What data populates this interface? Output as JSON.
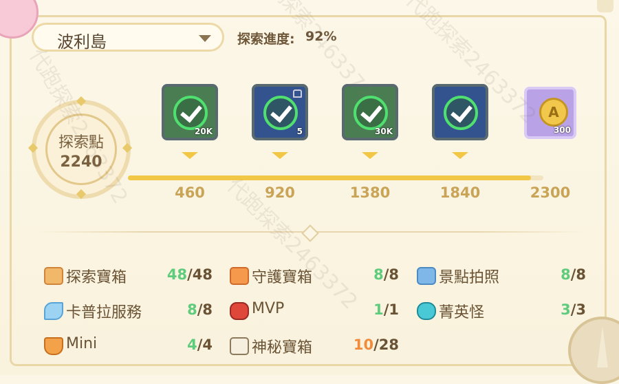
{
  "region_selector": {
    "value": "波利島"
  },
  "progress": {
    "label": "探索進度:",
    "value": "92%"
  },
  "points": {
    "title": "探索點",
    "value": "2240"
  },
  "milestones": [
    {
      "value": "460",
      "reward_qty": "20K",
      "reward_icon": "coin-chest-icon",
      "claimed": true,
      "locked": false
    },
    {
      "value": "920",
      "reward_qty": "5",
      "reward_icon": "ore-icon",
      "claimed": true,
      "locked": true
    },
    {
      "value": "1380",
      "reward_qty": "30K",
      "reward_icon": "coin-chest-icon",
      "claimed": true,
      "locked": false
    },
    {
      "value": "1840",
      "reward_qty": "",
      "reward_icon": "gem-bag-icon",
      "claimed": true,
      "locked": false
    },
    {
      "value": "2300",
      "reward_qty": "300",
      "reward_icon": "a-coin-icon",
      "claimed": false,
      "locked": false
    }
  ],
  "reward_coin_letter": "A",
  "track_progress_fraction": 0.97,
  "stats": [
    {
      "label": "探索寶箱",
      "done": "48",
      "total": "48",
      "icon": "treasure-chest-icon",
      "done_color": "green"
    },
    {
      "label": "守護寶箱",
      "done": "8",
      "total": "8",
      "icon": "guardian-chest-icon",
      "done_color": "green"
    },
    {
      "label": "景點拍照",
      "done": "8",
      "total": "8",
      "icon": "camera-icon",
      "done_color": "green"
    },
    {
      "label": "卡普拉服務",
      "done": "8",
      "total": "8",
      "icon": "feather-icon",
      "done_color": "green"
    },
    {
      "label": "MVP",
      "done": "1",
      "total": "1",
      "icon": "mvp-demon-icon",
      "done_color": "green"
    },
    {
      "label": "菁英怪",
      "done": "3",
      "total": "3",
      "icon": "elite-skull-icon",
      "done_color": "green"
    },
    {
      "label": "Mini",
      "done": "4",
      "total": "4",
      "icon": "mini-fox-icon",
      "done_color": "green"
    },
    {
      "label": "神秘寶箱",
      "done": "10",
      "total": "28",
      "icon": "mystery-chest-icon",
      "done_color": "orange"
    }
  ],
  "watermark": "代跑探索2463372",
  "colors": {
    "accent": "#f3c746",
    "done_green": "#5fcb7c",
    "pending_orange": "#f08c3c",
    "text": "#6a5335"
  }
}
